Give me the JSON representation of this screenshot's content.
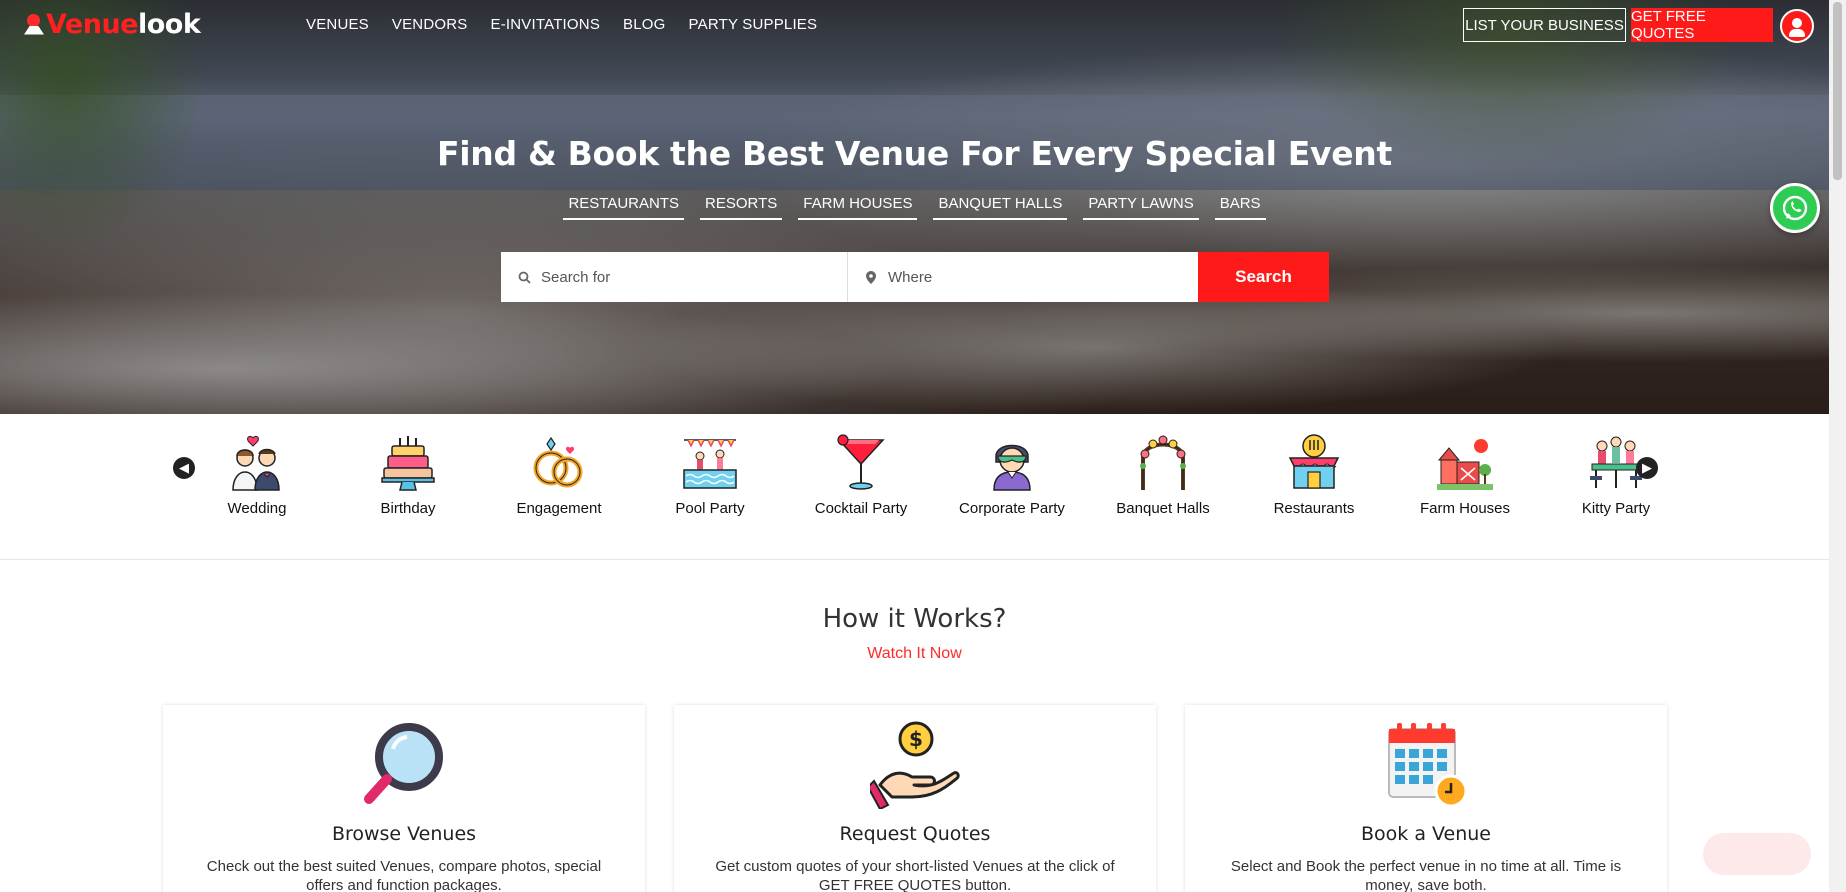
{
  "brand": {
    "name_part1": "Venue",
    "name_part2": "look",
    "accent": "#ff1a1a"
  },
  "nav": {
    "items": [
      "VENUES",
      "VENDORS",
      "E-INVITATIONS",
      "BLOG",
      "PARTY SUPPLIES"
    ],
    "list_business": "LIST YOUR BUSINESS",
    "get_quotes": "GET FREE QUOTES",
    "user_icon": "user-icon"
  },
  "hero": {
    "title": "Find & Book the Best Venue For Every Special Event",
    "quick_links": [
      "RESTAURANTS",
      "RESORTS",
      "FARM HOUSES",
      "BANQUET HALLS",
      "PARTY LAWNS",
      "BARS"
    ],
    "search_placeholder": "Search for",
    "where_placeholder": "Where",
    "search_button": "Search"
  },
  "categories": [
    "Wedding",
    "Birthday",
    "Engagement",
    "Pool Party",
    "Cocktail Party",
    "Corporate Party",
    "Banquet Halls",
    "Restaurants",
    "Farm Houses",
    "Kitty Party"
  ],
  "how": {
    "title": "How it Works?",
    "subtitle": "Watch It Now",
    "cards": [
      {
        "title": "Browse Venues",
        "desc": "Check out the best suited Venues, compare photos, special offers and function packages."
      },
      {
        "title": "Request Quotes",
        "desc": "Get custom quotes of your short-listed Venues at the click of GET FREE QUOTES button."
      },
      {
        "title": "Book a Venue",
        "desc": "Select and Book the perfect venue in no time at all. Time is money, save both."
      }
    ]
  }
}
